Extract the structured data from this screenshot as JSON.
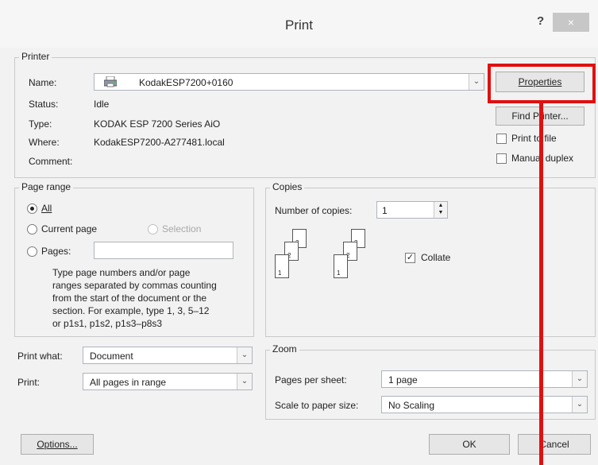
{
  "window": {
    "title": "Print",
    "help": "?",
    "close": "×"
  },
  "printer": {
    "legend": "Printer",
    "name_label": "Name:",
    "name_value": "KodakESP7200+0160",
    "status_label": "Status:",
    "status_value": "Idle",
    "type_label": "Type:",
    "type_value": "KODAK ESP 7200 Series AiO",
    "where_label": "Where:",
    "where_value": "KodakESP7200-A277481.local",
    "comment_label": "Comment:",
    "properties_button": "Properties",
    "find_printer_button": "Find Printer...",
    "print_to_file_label": "Print to file",
    "manual_duplex_label": "Manual duplex"
  },
  "page_range": {
    "legend": "Page range",
    "all_label": "All",
    "current_page_label": "Current page",
    "selection_label": "Selection",
    "pages_label": "Pages:",
    "pages_value": "",
    "help_text": [
      "Type page numbers and/or page",
      "ranges separated by commas counting",
      "from the start of the document or the",
      "section. For example, type 1, 3, 5–12",
      "or p1s1, p1s2, p1s3–p8s3"
    ]
  },
  "copies": {
    "legend": "Copies",
    "number_label": "Number of copies:",
    "number_value": "1",
    "collate_label": "Collate",
    "collate_checked": true
  },
  "print_what": {
    "label": "Print what:",
    "value": "Document"
  },
  "print": {
    "label": "Print:",
    "value": "All pages in range"
  },
  "zoom": {
    "legend": "Zoom",
    "pages_per_sheet_label": "Pages per sheet:",
    "pages_per_sheet_value": "1 page",
    "scale_label": "Scale to paper size:",
    "scale_value": "No Scaling"
  },
  "footer": {
    "options_button": "Options...",
    "ok_button": "OK",
    "cancel_button": "Cancel"
  },
  "colors": {
    "highlight": "#e01010"
  }
}
